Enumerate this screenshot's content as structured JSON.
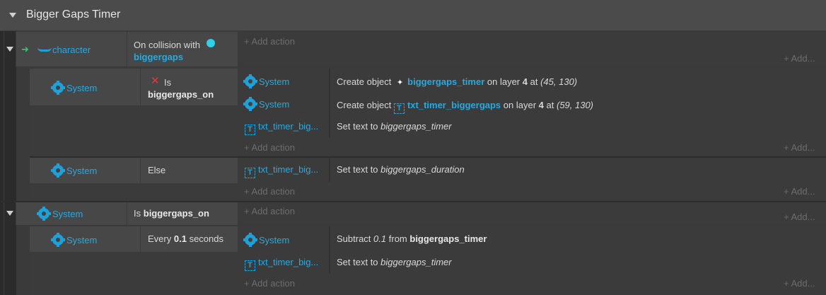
{
  "group": {
    "title": "Bigger Gaps Timer"
  },
  "events": [
    {
      "object": "character",
      "condition": {
        "prefix": "On collision with",
        "target": "biggergaps"
      }
    }
  ],
  "sub1": {
    "object": "System",
    "cond_prefix": "Is",
    "cond_var": "biggergaps_on",
    "actions": [
      {
        "object": "System",
        "text": "Create object",
        "target": "biggergaps_timer",
        "mid": "on layer",
        "layer": "4",
        "at": "at",
        "coords": "(45, 130)"
      },
      {
        "object": "System",
        "text": "Create object",
        "target": "txt_timer_biggergaps",
        "mid": "on layer",
        "layer": "4",
        "at": "at",
        "coords": "(59, 130)"
      },
      {
        "object": "txt_timer_big...",
        "text": "Set text to",
        "value": "biggergaps_timer"
      }
    ]
  },
  "sub2": {
    "object": "System",
    "condition": "Else",
    "actions": [
      {
        "object": "txt_timer_big...",
        "text": "Set text to",
        "value": "biggergaps_duration"
      }
    ]
  },
  "ev2": {
    "object": "System",
    "cond_prefix": "Is",
    "cond_var": "biggergaps_on"
  },
  "sub3": {
    "object": "System",
    "cond_prefix": "Every",
    "cond_value": "0.1",
    "cond_suffix": "seconds",
    "actions": [
      {
        "object": "System",
        "prefix": "Subtract",
        "amount": "0.1",
        "mid": "from",
        "var": "biggergaps_timer"
      },
      {
        "object": "txt_timer_big...",
        "text": "Set text to",
        "value": "biggergaps_timer"
      }
    ]
  },
  "labels": {
    "add_action": "Add action",
    "add": "Add..."
  },
  "colors": {
    "accent": "#27a9e1",
    "header": "#4b4b4b",
    "panel": "#404040",
    "inverted": "#e03c3c"
  }
}
